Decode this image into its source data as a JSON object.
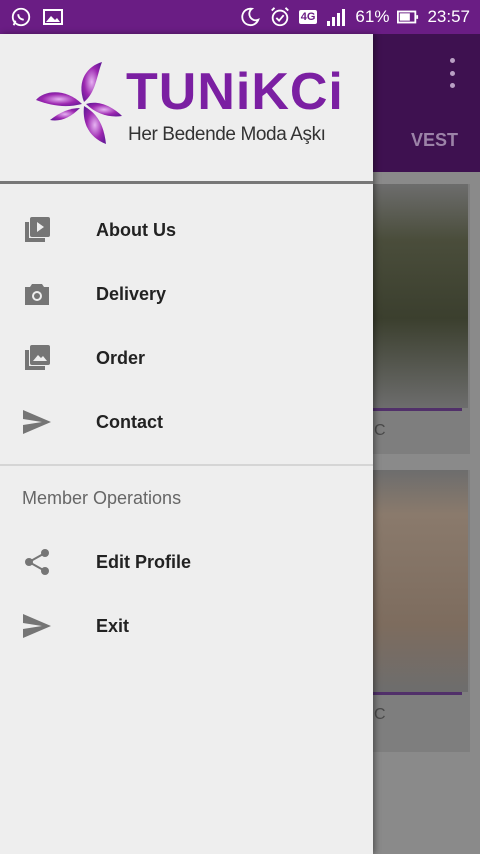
{
  "status_bar": {
    "network_tag": "4G",
    "battery": "61%",
    "time": "23:57",
    "icons": [
      "whatsapp-icon",
      "gallery-notification-icon",
      "moon-icon",
      "alarm-icon",
      "signal-icon",
      "battery-icon"
    ]
  },
  "app": {
    "tab_label": "VEST",
    "cards": [
      {
        "code": "C",
        "sub": ""
      },
      {
        "code": "C",
        "sub": ""
      }
    ]
  },
  "drawer": {
    "logo": {
      "brand": "TUNiKCi",
      "tagline": "Her Bedende Moda Aşkı"
    },
    "menu": [
      {
        "label": "About Us",
        "icon": "video-library-icon"
      },
      {
        "label": "Delivery",
        "icon": "camera-icon"
      },
      {
        "label": "Order",
        "icon": "photo-library-icon"
      },
      {
        "label": "Contact",
        "icon": "send-icon"
      }
    ],
    "section_title": "Member Operations",
    "member_menu": [
      {
        "label": "Edit Profile",
        "icon": "share-icon"
      },
      {
        "label": "Exit",
        "icon": "send-icon"
      }
    ]
  },
  "colors": {
    "brand_purple": "#7b1fa2",
    "status_bar": "#6a1d84",
    "drawer_bg": "#eeeeee",
    "icon_gray": "#757575"
  }
}
